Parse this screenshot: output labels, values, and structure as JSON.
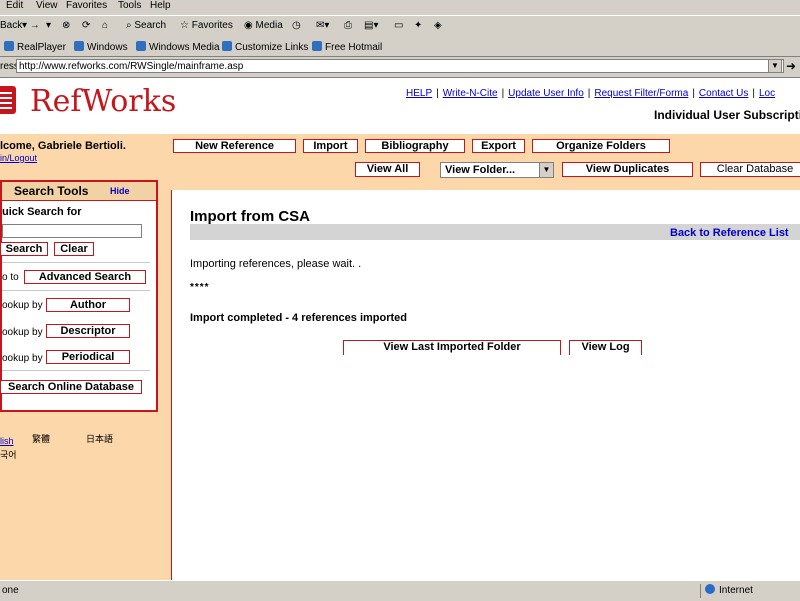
{
  "browser": {
    "menu": [
      "Edit",
      "View",
      "Favorites",
      "Tools",
      "Help"
    ],
    "toolbar": {
      "back": "Back",
      "search": "Search",
      "favorites": "Favorites",
      "media": "Media"
    },
    "links": [
      "RealPlayer",
      "Windows",
      "Windows Media",
      "Customize Links",
      "Free Hotmail"
    ],
    "address_label": "ress",
    "address_url": "http://www.refworks.com/RWSingle/mainframe.asp",
    "status_text": "one",
    "status_zone": "Internet"
  },
  "header": {
    "logo": "RefWorks",
    "top_links": [
      "HELP",
      "Write-N-Cite",
      "Update User Info",
      "Request Filter/Forma",
      "Contact Us",
      "Loc"
    ],
    "subtitle": "Individual User Subscripti"
  },
  "user": {
    "welcome": "lcome, Gabriele Bertioli.",
    "login_logout": "in/Logout"
  },
  "nav": {
    "new_reference": "New Reference",
    "import": "Import",
    "bibliography": "Bibliography",
    "export": "Export",
    "organize_folders": "Organize Folders",
    "view_all": "View All",
    "view_folder": "View Folder...",
    "view_duplicates": "View Duplicates",
    "clear_database": "Clear Database"
  },
  "sidebar": {
    "title": "Search Tools",
    "hide": "Hide",
    "quick_search_label": "uick Search for",
    "search_btn": "Search",
    "clear_btn": "Clear",
    "goto_label": "o to",
    "advanced_search": "Advanced Search",
    "lookup_label": "ookup by",
    "author": "Author",
    "descriptor": "Descriptor",
    "periodical": "Periodical",
    "search_online": "Search Online Database",
    "bottom_link": "lish",
    "lang1": "繁體",
    "lang2": "日本語",
    "lang3": "국어"
  },
  "main": {
    "title": "Import from CSA",
    "back_link": "Back to Reference List",
    "importing": "Importing references, please wait. .",
    "progress": "****",
    "completed": "Import completed - 4 references imported",
    "view_last": "View Last Imported Folder",
    "view_log": "View Log"
  }
}
